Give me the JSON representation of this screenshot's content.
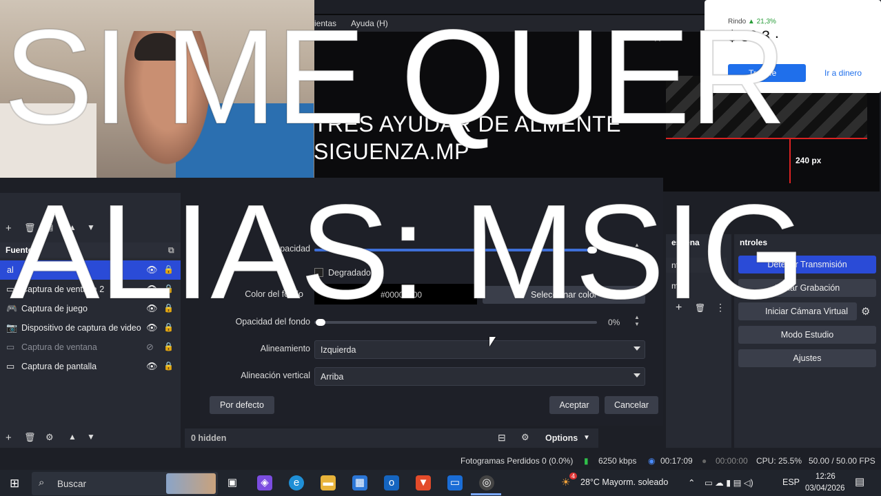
{
  "obs": {
    "menu": {
      "tools": "ientas",
      "help": "Ayuda (H)"
    },
    "preview_text": {
      "line1": "TRES AYUDAR DE ALMENTE",
      "line2": "SIGUENZA.MP"
    },
    "ruler_label": "240 px",
    "sources_title": "Fuentes",
    "sources": [
      {
        "label": "al",
        "icon": "text-icon",
        "visible": true,
        "selected": true
      },
      {
        "label": "Captura de ventana 2",
        "icon": "window-icon",
        "visible": true
      },
      {
        "label": "Captura de juego",
        "icon": "gamepad-icon",
        "visible": true
      },
      {
        "label": "Dispositivo de captura de video",
        "icon": "camera-icon",
        "visible": true
      },
      {
        "label": "Captura de ventana",
        "icon": "window-icon",
        "visible": false
      },
      {
        "label": "Captura de pantalla",
        "icon": "monitor-icon",
        "visible": true
      }
    ],
    "properties": {
      "opacity_label": "Opacidad",
      "opacity_value": "0%",
      "gradient_label": "Degradado",
      "bgcolor_label": "Color del fondo",
      "bgcolor_value": "#00000000",
      "select_color": "Seleccionar color",
      "bgopacity_label": "Opacidad del fondo",
      "bgopacity_value": "0%",
      "bgopacity_level": 0,
      "align_label": "Alineamiento",
      "align_value": "Izquierda",
      "valign_label": "Alineación vertical",
      "valign_value": "Arriba",
      "defaults_btn": "Por defecto",
      "ok_btn": "Aceptar",
      "cancel_btn": "Cancelar"
    },
    "scene_transitions_title": "escena",
    "scene_transition_item": "nto",
    "scene_duration_item": "ms",
    "controls_title": "ntroles",
    "controls": {
      "stop_stream": "Detener Transmisión",
      "start_rec": "Iniciar Grabación",
      "virtual_cam": "Iniciar Cámara Virtual",
      "studio_mode": "Modo Estudio",
      "settings": "Ajustes"
    },
    "midbar": {
      "hidden": "0 hidden",
      "options": "Options"
    },
    "status": {
      "dropped": "Fotogramas Perdidos 0 (0.0%)",
      "kbps": "6250 kbps",
      "live_time": "00:17:09",
      "rec_time": "00:00:00",
      "cpu": "CPU: 25.5%",
      "fps": "50.00 / 50.00 FPS"
    }
  },
  "popup": {
    "label": "Rindo",
    "change": "▲ 21,3%",
    "amount": "$ 30.3 ·",
    "btn1": "Transfe",
    "btn2": "Ir a dinero"
  },
  "overlay": {
    "line1": "SI ME QUER",
    "line2": "ALIAS: MSIG"
  },
  "taskbar": {
    "search_placeholder": "Buscar",
    "weather": "28°C  Mayorm. soleado",
    "weather_badge": "4",
    "lang": "ESP",
    "time": "12:26",
    "date": "03/04/2026"
  }
}
